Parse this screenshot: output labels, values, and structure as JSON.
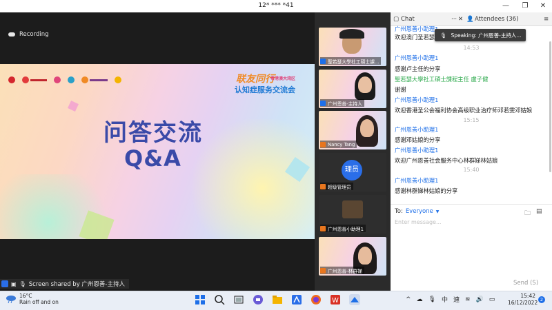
{
  "window": {
    "title": "12* *** *41"
  },
  "recording": {
    "label": "Recording"
  },
  "slide": {
    "title_cn": "问答交流",
    "title_en": "Q&A",
    "brand_top": "联友同行",
    "brand_sub": "粤港澳大湾区",
    "brand_main": "认知症服务交流会"
  },
  "share_bar": {
    "label": "Screen shared by 广州恩善-主持人"
  },
  "video_tiles": [
    {
      "name": "聖若瑟大學社工碩士課..."
    },
    {
      "name": "广州恩善-主持人"
    },
    {
      "name": "Nancy Tang"
    },
    {
      "name": "超级管理员",
      "avatar_text": "理员"
    },
    {
      "name": "广州恩善小助理1"
    },
    {
      "name": "广州恩善-林群娣"
    }
  ],
  "chat": {
    "tab_chat": "Chat",
    "tab_attendees": "Attendees (36)",
    "speaking": "Speaking: 广州恩善-主持人...",
    "messages": [
      {
        "sender": "广州恩善小助理1",
        "body": "欢迎澳门圣若瑟大学社工硕士"
      },
      {
        "time": "14:53"
      },
      {
        "sender": "广州恩善小助理1",
        "body": "感谢卢主任的分享"
      },
      {
        "sender": "聖若瑟大學社工碩士課程主任 盧子健",
        "body": "谢谢",
        "green": true
      },
      {
        "sender": "广州恩善小助理1",
        "body": "欢迎香港圣公会福利协会高级职业治疗师邓若雯邓姑娘"
      },
      {
        "time": "15:15"
      },
      {
        "sender": "广州恩善小助理1",
        "body": "感谢邓姑娘的分享"
      },
      {
        "sender": "广州恩善小助理1",
        "body": "欢迎广州恩善社会服务中心林群娣林姑娘"
      },
      {
        "time": "15:40"
      },
      {
        "sender": "广州恩善小助理1",
        "body": "感谢林群娣林姑娘的分享"
      }
    ],
    "to_label": "To:",
    "to_value": "Everyone",
    "placeholder": "Enter message...",
    "send": "Send (S)"
  },
  "taskbar": {
    "temp": "16°C",
    "weather": "Rain off and on",
    "ime1": "中",
    "ime2": "速",
    "time": "15:42",
    "date": "16/12/2022",
    "notif_count": "2"
  },
  "colors": {
    "accent": "#1e6fe8",
    "slide_text": "#3a4aa8",
    "green_sender": "#2aa84a"
  }
}
